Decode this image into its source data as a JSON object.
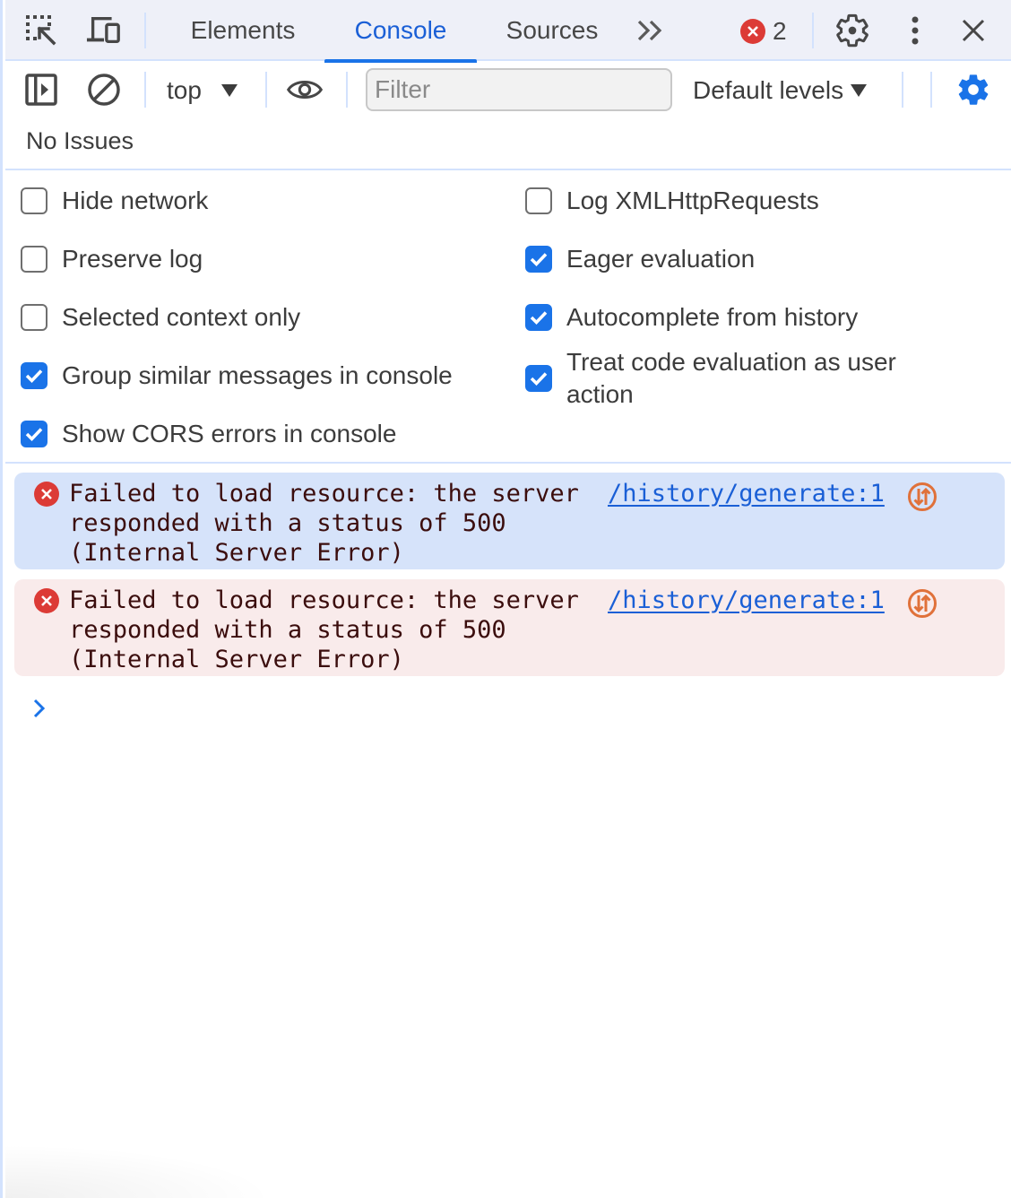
{
  "tabbar": {
    "icons": {
      "inspect": "inspect-element-icon",
      "device": "device-toolbar-icon",
      "more_tabs": "more-tabs-icon",
      "settings": "settings-gear-icon",
      "menu": "more-vertical-icon",
      "close": "close-icon"
    },
    "tabs": [
      {
        "label": "Elements",
        "active": false
      },
      {
        "label": "Console",
        "active": true
      },
      {
        "label": "Sources",
        "active": false
      }
    ],
    "error_count": "2"
  },
  "toolbar": {
    "context": "top",
    "filter_placeholder": "Filter",
    "filter_value": "",
    "levels": "Default levels",
    "issues": "No Issues",
    "accent_color": "#1a73e8"
  },
  "settings": {
    "left": [
      {
        "label": "Hide network",
        "checked": false
      },
      {
        "label": "Preserve log",
        "checked": false
      },
      {
        "label": "Selected context only",
        "checked": false
      },
      {
        "label": "Group similar messages in console",
        "checked": true
      },
      {
        "label": "Show CORS errors in console",
        "checked": true
      }
    ],
    "right": [
      {
        "label": "Log XMLHttpRequests",
        "checked": false
      },
      {
        "label": "Eager evaluation",
        "checked": true
      },
      {
        "label": "Autocomplete from history",
        "checked": true
      },
      {
        "label": "Treat code evaluation as user action",
        "checked": true
      }
    ]
  },
  "messages": [
    {
      "level": "error",
      "text_lines": [
        "Failed to load resource: the server",
        "responded with a status of 500",
        "(Internal Server Error)"
      ],
      "source": "/history/generate:1",
      "highlighted": true
    },
    {
      "level": "error",
      "text_lines": [
        "Failed to load resource: the server",
        "responded with a status of 500",
        "(Internal Server Error)"
      ],
      "source": "/history/generate:1",
      "highlighted": false
    }
  ],
  "colors": {
    "error_red": "#dc3b36",
    "link_blue": "#1a5fd6",
    "network_orange": "#e0713a",
    "selected_row": "#d6e3fa",
    "error_row": "#f9ebeb"
  }
}
